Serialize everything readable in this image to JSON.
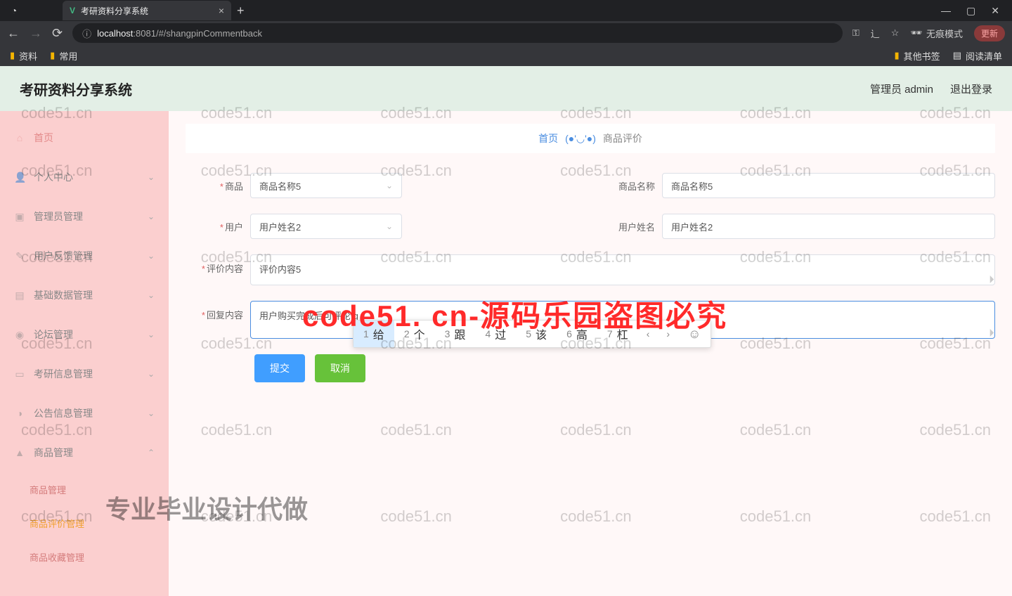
{
  "browser": {
    "tab_title": "考研资料分享系统",
    "url_host": "localhost",
    "url_port": ":8081",
    "url_path": "/#/shangpinCommentback",
    "incognito": "无痕模式",
    "update": "更新",
    "bookmarks": {
      "b1": "资料",
      "b2": "常用",
      "r1": "其他书签",
      "r2": "阅读清单"
    }
  },
  "header": {
    "title": "考研资料分享系统",
    "admin": "管理员 admin",
    "logout": "退出登录"
  },
  "sidebar": {
    "items": [
      {
        "label": "首页"
      },
      {
        "label": "个人中心"
      },
      {
        "label": "管理员管理"
      },
      {
        "label": "用户反馈管理"
      },
      {
        "label": "基础数据管理"
      },
      {
        "label": "论坛管理"
      },
      {
        "label": "考研信息管理"
      },
      {
        "label": "公告信息管理"
      },
      {
        "label": "商品管理"
      }
    ],
    "subs": [
      {
        "label": "商品管理"
      },
      {
        "label": "商品评价管理"
      },
      {
        "label": "商品收藏管理"
      }
    ]
  },
  "breadcrumb": {
    "home": "首页",
    "face": "(●'◡'●)",
    "current": "商品评价"
  },
  "form": {
    "product_label": "商品",
    "product_value": "商品名称5",
    "product_name_label": "商品名称",
    "product_name_value": "商品名称5",
    "user_label": "用户",
    "user_value": "用户姓名2",
    "user_name_label": "用户姓名",
    "user_name_value": "用户姓名2",
    "comment_label": "评价内容",
    "comment_value": "评价内容5",
    "reply_label": "回复内容",
    "reply_value": "用户购买完成后可评论 g",
    "submit": "提交",
    "cancel": "取消"
  },
  "ime": {
    "candidates": [
      {
        "n": "1",
        "t": "给"
      },
      {
        "n": "2",
        "t": "个"
      },
      {
        "n": "3",
        "t": "跟"
      },
      {
        "n": "4",
        "t": "过"
      },
      {
        "n": "5",
        "t": "该"
      },
      {
        "n": "6",
        "t": "高"
      },
      {
        "n": "7",
        "t": "杠"
      }
    ]
  },
  "watermark": {
    "text": "code51.cn",
    "big": "code51. cn-源码乐园盗图必究",
    "bottom": "专业毕业设计代做"
  }
}
